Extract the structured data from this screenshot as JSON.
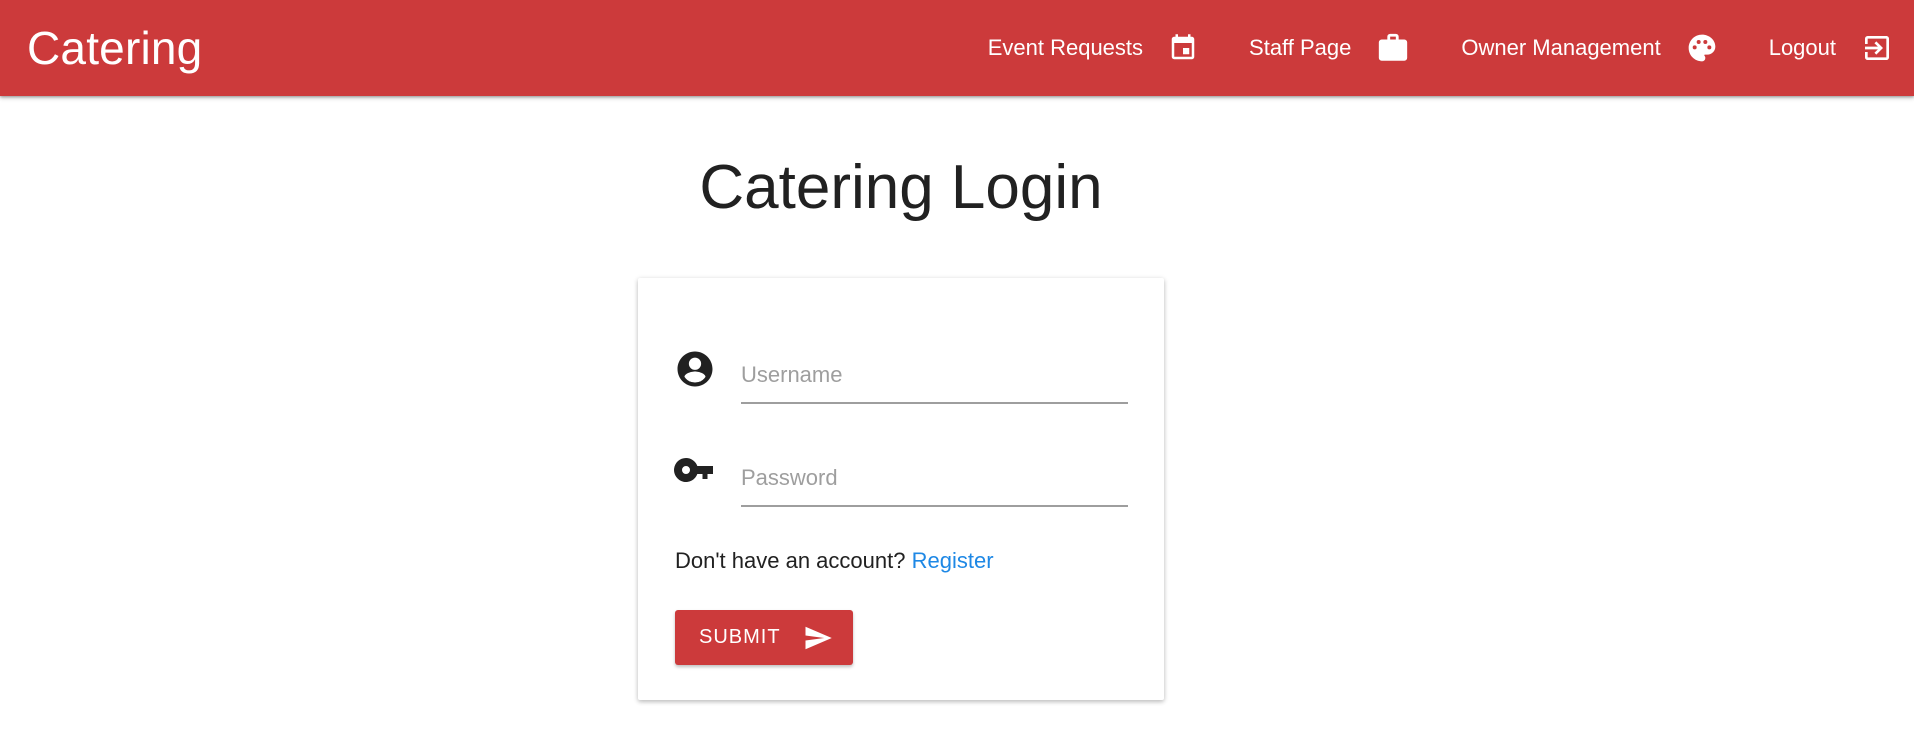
{
  "app": {
    "brand": "Catering"
  },
  "nav": {
    "items": [
      {
        "label": "Event Requests",
        "icon": "calendar-icon"
      },
      {
        "label": "Staff Page",
        "icon": "briefcase-icon"
      },
      {
        "label": "Owner Management",
        "icon": "palette-icon"
      },
      {
        "label": "Logout",
        "icon": "logout-icon"
      }
    ]
  },
  "page": {
    "title": "Catering Login"
  },
  "form": {
    "username": {
      "placeholder": "Username",
      "value": "",
      "icon": "account-circle-icon"
    },
    "password": {
      "placeholder": "Password",
      "value": "",
      "icon": "key-icon"
    },
    "register_prompt": "Don't have an account?",
    "register_link": "Register",
    "submit_label": "SUBMIT",
    "submit_icon": "send-icon"
  },
  "colors": {
    "primary": "#cc3a3b",
    "link": "#1e88e5",
    "text": "#212121",
    "placeholder": "#9e9e9e"
  }
}
